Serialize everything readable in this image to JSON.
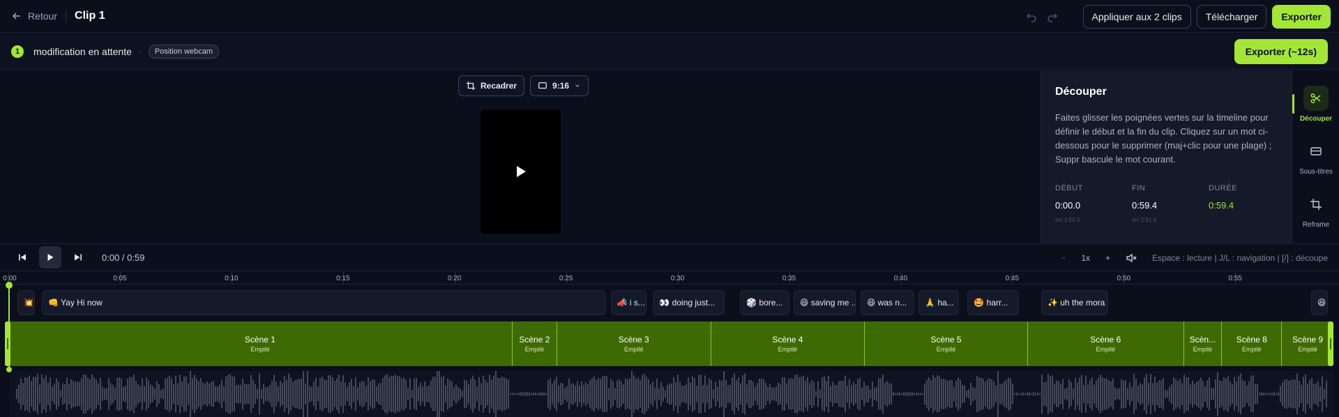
{
  "topbar": {
    "back_label": "Retour",
    "clip_title": "Clip 1",
    "apply_label": "Appliquer aux 2 clips",
    "download_label": "Télécharger",
    "export_label": "Exporter"
  },
  "pending": {
    "count": "1",
    "text": "modification en attente",
    "separator": "·",
    "chip": "Position webcam",
    "export_estimate_label": "Exporter (~12s)"
  },
  "preview": {
    "reframe_label": "Recadrer",
    "aspect_label": "9:16"
  },
  "panel": {
    "title": "Découper",
    "description": "Faites glisser les poignées vertes sur la timeline pour définir le début et la fin du clip. Cliquez sur un mot ci-dessous pour le supprimer (maj+clic pour une plage) ; Suppr bascule le mot courant.",
    "start_label": "DÉBUT",
    "start_value": "0:00.0",
    "start_src": "src 1:52.0",
    "end_label": "FIN",
    "end_value": "0:59.4",
    "end_src": "src 2:51.4",
    "duration_label": "DURÉE",
    "duration_value": "0:59.4"
  },
  "rail": {
    "items": [
      {
        "label": "Découper",
        "icon": "scissors-icon",
        "active": true
      },
      {
        "label": "Sous-titres",
        "icon": "subtitles-icon",
        "active": false
      },
      {
        "label": "Reframe",
        "icon": "crop-icon",
        "active": false
      }
    ]
  },
  "transport": {
    "timecode": "0:00 / 0:59",
    "zoom_out": "−",
    "speed": "1x",
    "zoom_in": "+",
    "hint": "Espace : lecture | J/L : navigation | [/] : découpe"
  },
  "ruler": {
    "ticks": [
      "0:00",
      "0:05",
      "0:10",
      "0:15",
      "0:20",
      "0:25",
      "0:30",
      "0:35",
      "0:40",
      "0:45",
      "0:50",
      "0:55"
    ]
  },
  "words": [
    {
      "text": "💥",
      "start": 0.4,
      "end": 1.2
    },
    {
      "text": "👊 Yay Hi now",
      "start": 1.5,
      "end": 26.8
    },
    {
      "text": "📣 i s...",
      "start": 27.0,
      "end": 28.6
    },
    {
      "text": "👀 doing just...",
      "start": 28.9,
      "end": 32.1
    },
    {
      "text": "🎲 bore...",
      "start": 32.8,
      "end": 35.0
    },
    {
      "text": "😆 saving me ...",
      "start": 35.2,
      "end": 38.0
    },
    {
      "text": "😆 was n...",
      "start": 38.2,
      "end": 40.6
    },
    {
      "text": "🙏 ha...",
      "start": 40.8,
      "end": 42.6
    },
    {
      "text": "🤩 harr...",
      "start": 43.0,
      "end": 45.3
    },
    {
      "text": "✨ uh the mora",
      "start": 46.3,
      "end": 49.3
    },
    {
      "text": "😆",
      "start": 58.4,
      "end": 59.1
    }
  ],
  "scenes": [
    {
      "name": "Scène 1",
      "sub": "Empilé",
      "start": 0.0,
      "end": 22.6
    },
    {
      "name": "Scène 2",
      "sub": "Empilé",
      "start": 22.6,
      "end": 24.6
    },
    {
      "name": "Scène 3",
      "sub": "Empilé",
      "start": 24.6,
      "end": 31.5
    },
    {
      "name": "Scène 4",
      "sub": "Empilé",
      "start": 31.5,
      "end": 38.4
    },
    {
      "name": "Scène 5",
      "sub": "Empilé",
      "start": 38.4,
      "end": 45.7
    },
    {
      "name": "Scène 6",
      "sub": "Empilé",
      "start": 45.7,
      "end": 52.7
    },
    {
      "name": "Scèn...",
      "sub": "Empilé",
      "start": 52.7,
      "end": 54.4
    },
    {
      "name": "Scène 8",
      "sub": "Empilé",
      "start": 54.4,
      "end": 57.1
    },
    {
      "name": "Scène 9",
      "sub": "Empilé",
      "start": 57.1,
      "end": 59.4
    }
  ],
  "timeline": {
    "duration": 59.4,
    "playhead": 0.0
  },
  "colors": {
    "accent": "#a3e635",
    "scene_fill": "#3e6a04",
    "background": "#0b0f1c"
  }
}
